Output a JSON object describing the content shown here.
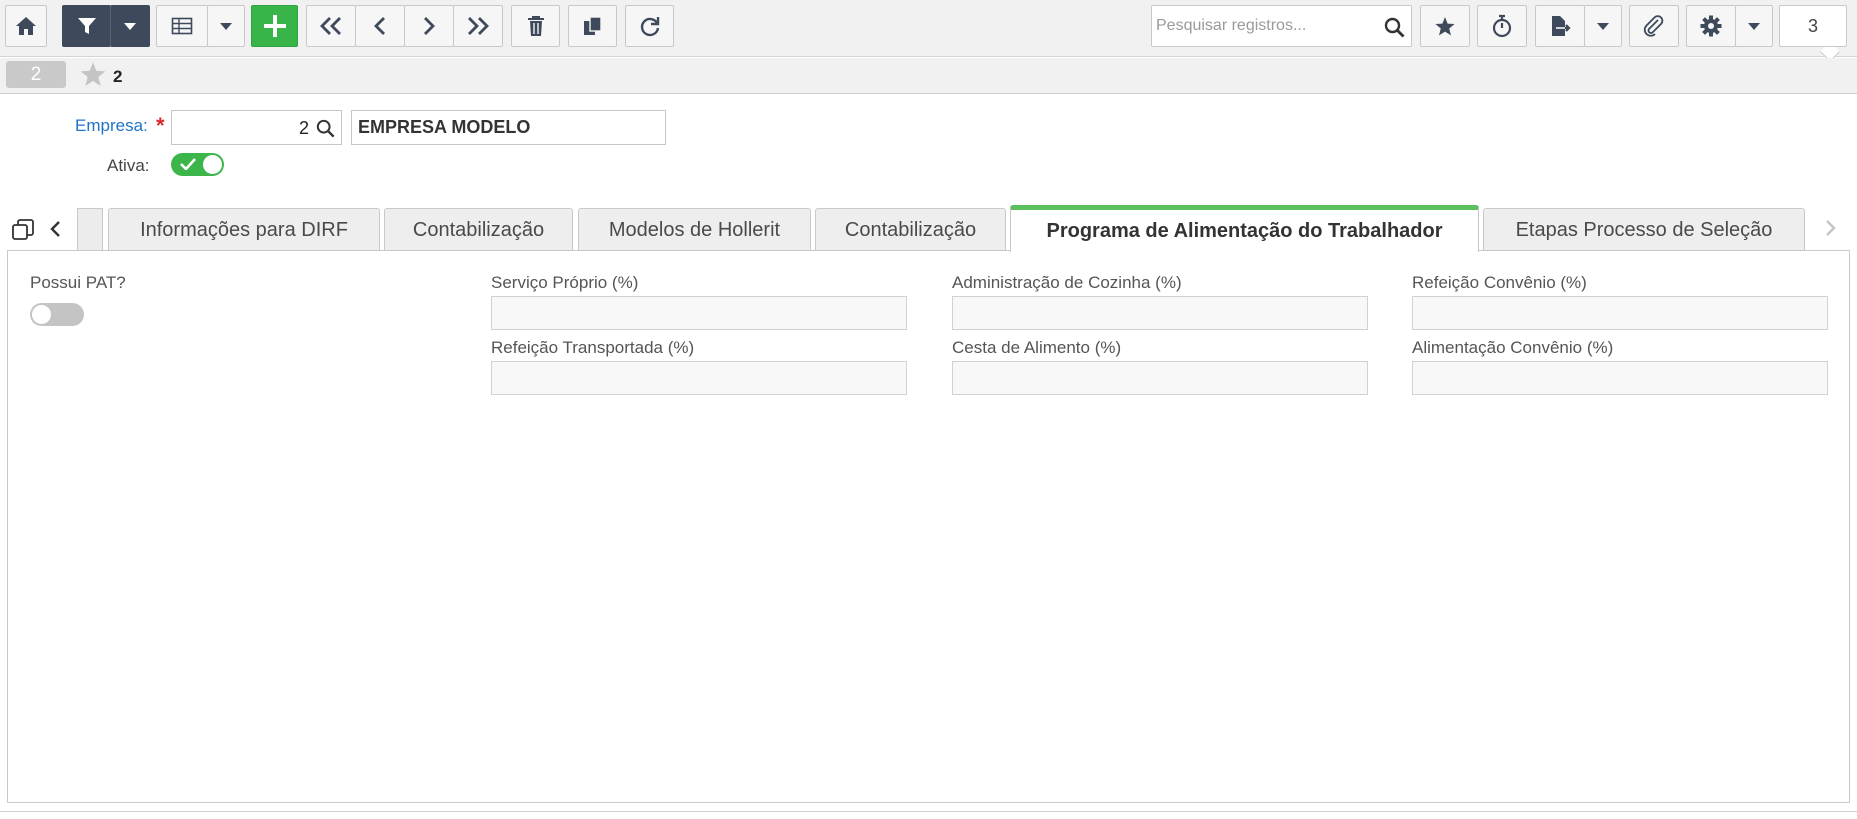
{
  "toolbar": {
    "buttons": [
      {
        "name": "home-button",
        "icon": "home-icon"
      },
      {
        "name": "filter-button",
        "icon": "filter-icon"
      },
      {
        "name": "filter-dropdown-button",
        "icon": "caret-down-icon"
      },
      {
        "name": "grid-view-button",
        "icon": "grid-icon"
      },
      {
        "name": "grid-dropdown-button",
        "icon": "caret-down-icon"
      },
      {
        "name": "new-record-button",
        "icon": "plus-icon"
      },
      {
        "name": "first-record-button",
        "icon": "double-chevron-left-icon"
      },
      {
        "name": "previous-record-button",
        "icon": "chevron-left-icon"
      },
      {
        "name": "next-record-button",
        "icon": "chevron-right-icon"
      },
      {
        "name": "last-record-button",
        "icon": "double-chevron-right-icon"
      },
      {
        "name": "delete-button",
        "icon": "trash-icon"
      },
      {
        "name": "copy-button",
        "icon": "copy-icon"
      },
      {
        "name": "refresh-button",
        "icon": "refresh-icon"
      }
    ],
    "search": {
      "placeholder": "Pesquisar registros..."
    },
    "right_buttons": [
      {
        "name": "favorites-button",
        "icon": "star-icon"
      },
      {
        "name": "timer-button",
        "icon": "stopwatch-icon"
      },
      {
        "name": "export-button",
        "icon": "file-export-icon"
      },
      {
        "name": "export-dropdown-button",
        "icon": "caret-down-icon"
      },
      {
        "name": "attachment-button",
        "icon": "paperclip-icon"
      },
      {
        "name": "settings-button",
        "icon": "gear-icon"
      },
      {
        "name": "settings-dropdown-button",
        "icon": "caret-down-icon"
      }
    ],
    "notification_count": "3"
  },
  "record": {
    "badge": "2",
    "favorite_number": "2"
  },
  "header_fields": {
    "empresa_label": "Empresa:",
    "empresa_required": "*",
    "empresa_code": "2",
    "empresa_name": "EMPRESA MODELO",
    "ativa_label": "Ativa:",
    "ativa_value": true
  },
  "tabs": [
    {
      "label": "Informações para DIRF",
      "active": false
    },
    {
      "label": "Contabilização",
      "active": false
    },
    {
      "label": "Modelos de Hollerit",
      "active": false
    },
    {
      "label": "Contabilização",
      "active": false
    },
    {
      "label": "Programa de Alimentação do Trabalhador",
      "active": true
    },
    {
      "label": "Etapas Processo de Seleção",
      "active": false
    }
  ],
  "pat_form": {
    "possui_pat_label": "Possui PAT?",
    "possui_pat_value": false,
    "fields": [
      {
        "label": "Serviço Próprio (%)",
        "value": ""
      },
      {
        "label": "Administração de Cozinha (%)",
        "value": ""
      },
      {
        "label": "Refeição Convênio (%)",
        "value": ""
      },
      {
        "label": "Refeição Transportada (%)",
        "value": ""
      },
      {
        "label": "Cesta de Alimento (%)",
        "value": ""
      },
      {
        "label": "Alimentação Convênio (%)",
        "value": ""
      }
    ]
  },
  "colors": {
    "toolbar_dark": "#3e4a5b",
    "new_button_green": "#38b449",
    "active_tab_accent": "#5cc05e",
    "link_blue": "#1f73c8",
    "required_red": "#d9282f"
  }
}
